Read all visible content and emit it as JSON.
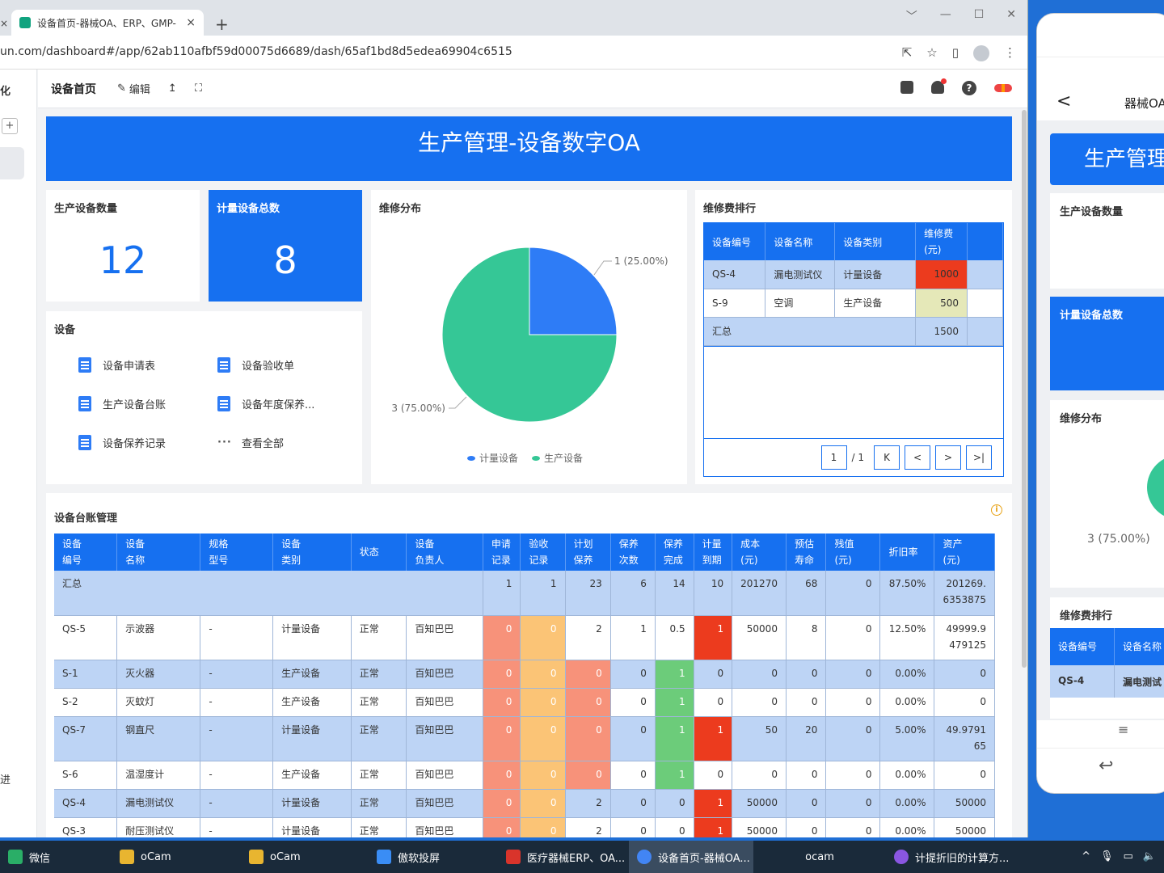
{
  "browser": {
    "prev_tab_hint": "×",
    "tab_title": "设备首页-器械OA、ERP、GMP-",
    "tab_close": "×",
    "new_tab": "+",
    "url": "un.com/dashboard#/app/62ab110afbf59d00075d6689/dash/65af1bd8d5edea69904c6515",
    "window_controls": [
      "﹀",
      "—",
      "☐",
      "✕"
    ]
  },
  "leftnav": {
    "top_text": "化",
    "plus": "+",
    "bottom_text": "进"
  },
  "toolbar": {
    "page_title": "设备首页",
    "edit": "编辑",
    "share_icon": "↥",
    "fullscreen_icon": "⛶",
    "help": "?"
  },
  "banner": {
    "title": "生产管理-设备数字OA"
  },
  "stats": {
    "production_count": {
      "label": "生产设备数量",
      "value": "12"
    },
    "metering_total": {
      "label": "计量设备总数",
      "value": "8"
    }
  },
  "equipment_links": {
    "title": "设备",
    "items": [
      "设备申请表",
      "设备验收单",
      "生产设备台账",
      "设备年度保养...",
      "设备保养记录",
      "查看全部"
    ]
  },
  "pie": {
    "title": "维修分布",
    "label_a": "1 (25.00%)",
    "label_b": "3 (75.00%)",
    "legend": [
      "计量设备",
      "生产设备"
    ]
  },
  "chart_data": {
    "type": "pie",
    "title": "维修分布",
    "categories": [
      "计量设备",
      "生产设备"
    ],
    "values": [
      1,
      3
    ],
    "percent": [
      25.0,
      75.0
    ],
    "colors": [
      "#2e7cf6",
      "#35c796"
    ],
    "legend_position": "bottom"
  },
  "repair_ranking": {
    "title": "维修费排行",
    "headers": [
      "设备编号",
      "设备名称",
      "设备类别",
      "维修费(元)"
    ],
    "rows": [
      [
        "QS-4",
        "漏电测试仪",
        "计量设备",
        "1000"
      ],
      [
        "S-9",
        "空调",
        "生产设备",
        "500"
      ]
    ],
    "total_label": "汇总",
    "total_value": "1500",
    "pager": {
      "page": "1",
      "of": "/ 1",
      "first": "K",
      "prev": "<",
      "next": ">",
      "last": ">|"
    }
  },
  "ledger": {
    "title": "设备台账管理",
    "headers": [
      "设备编号",
      "设备名称",
      "规格型号",
      "设备类别",
      "状态",
      "设备负责人",
      "申请记录",
      "验收记录",
      "计划保养",
      "保养次数",
      "保养完成",
      "计量到期",
      "成本(元)",
      "预估寿命",
      "残值(元)",
      "折旧率",
      "资产(元)"
    ],
    "summary": [
      "汇总",
      "",
      "",
      "",
      "",
      "",
      "1",
      "1",
      "23",
      "6",
      "14",
      "10",
      "201270",
      "68",
      "0",
      "87.50%",
      "201269.6353875"
    ],
    "rows": [
      [
        "QS-5",
        "示波器",
        "-",
        "计量设备",
        "正常",
        "百知巴巴",
        "0",
        "0",
        "2",
        "1",
        "0.5",
        "1",
        "50000",
        "8",
        "0",
        "12.50%",
        "49999.9479125"
      ],
      [
        "S-1",
        "灭火器",
        "-",
        "生产设备",
        "正常",
        "百知巴巴",
        "0",
        "0",
        "0",
        "0",
        "1",
        "0",
        "0",
        "0",
        "0",
        "0.00%",
        "0"
      ],
      [
        "S-2",
        "灭蚊灯",
        "-",
        "生产设备",
        "正常",
        "百知巴巴",
        "0",
        "0",
        "0",
        "0",
        "1",
        "0",
        "0",
        "0",
        "0",
        "0.00%",
        "0"
      ],
      [
        "QS-7",
        "钢直尺",
        "-",
        "计量设备",
        "正常",
        "百知巴巴",
        "0",
        "0",
        "0",
        "0",
        "1",
        "1",
        "50",
        "20",
        "0",
        "5.00%",
        "49.979165"
      ],
      [
        "S-6",
        "温湿度计",
        "-",
        "生产设备",
        "正常",
        "百知巴巴",
        "0",
        "0",
        "0",
        "0",
        "1",
        "0",
        "0",
        "0",
        "0",
        "0.00%",
        "0"
      ],
      [
        "QS-4",
        "漏电测试仪",
        "-",
        "计量设备",
        "正常",
        "百知巴巴",
        "0",
        "0",
        "2",
        "0",
        "0",
        "1",
        "50000",
        "0",
        "0",
        "0.00%",
        "50000"
      ],
      [
        "QS-3",
        "耐压测试仪",
        "-",
        "计量设备",
        "正常",
        "百知巴巴",
        "0",
        "0",
        "2",
        "0",
        "0",
        "1",
        "50000",
        "0",
        "0",
        "0.00%",
        "50000"
      ]
    ]
  },
  "phone": {
    "back": "<",
    "title": "器械OA",
    "banner": "生产管理",
    "card1": "生产设备数量",
    "card2": "计量设备总数",
    "card3": "维修分布",
    "pie_label": "3 (75.00%)",
    "card4": "维修费排行",
    "table_headers": [
      "设备编号",
      "设备名称"
    ],
    "table_row": [
      "QS-4",
      "漏电测试"
    ],
    "menu": "≡",
    "nav_back": "↩"
  },
  "taskbar": {
    "items": [
      "微信",
      "oCam",
      "oCam",
      "傲软投屏",
      "医疗器械ERP、OA...",
      "设备首页-器械OA...",
      "ocam",
      "计提折旧的计算方..."
    ],
    "colors": [
      "#2aae67",
      "#e8b530",
      "#e8b530",
      "#3a8df5",
      "#d9342b",
      "#4285f4",
      "#3a4c60",
      "#8a56e2"
    ]
  }
}
